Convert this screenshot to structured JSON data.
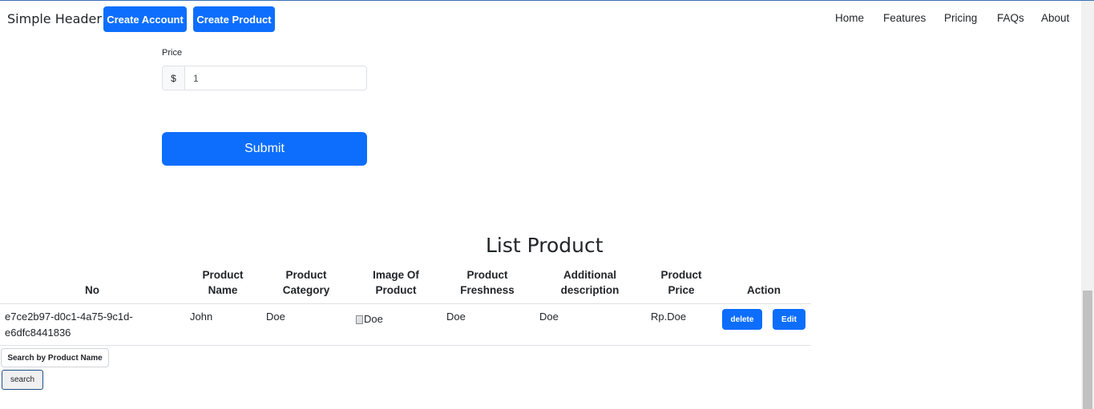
{
  "header": {
    "brand": "Simple Header",
    "buttons": {
      "create_account": "Create Account",
      "create_product": "Create Product"
    },
    "nav": [
      "Home",
      "Features",
      "Pricing",
      "FAQs",
      "About"
    ]
  },
  "form": {
    "price_label": "Price",
    "currency_addon": "$",
    "price_value": "1",
    "submit_label": "Submit"
  },
  "list": {
    "title": "List Product",
    "columns": {
      "no": "No",
      "product_name": [
        "Product",
        "Name"
      ],
      "product_category": [
        "Product",
        "Category"
      ],
      "image": [
        "Image Of",
        "Product"
      ],
      "freshness": [
        "Product",
        "Freshness"
      ],
      "description": [
        "Additional",
        "description"
      ],
      "price": [
        "Product",
        "Price"
      ],
      "action": "Action"
    },
    "rows": [
      {
        "no": [
          "e7ce2b97-d0c1-4a75-9c1d-",
          "e6dfc8441836"
        ],
        "name": "John",
        "category": "Doe",
        "image_alt": "Doe",
        "freshness": "Doe",
        "description": "Doe",
        "price": "Rp.Doe",
        "delete_label": "delete",
        "edit_label": "Edit"
      }
    ]
  },
  "search": {
    "label": "Search by Product Name",
    "button": "search"
  },
  "colors": {
    "primary": "#0d6efd",
    "text": "#212529",
    "border": "#dee2e6"
  }
}
